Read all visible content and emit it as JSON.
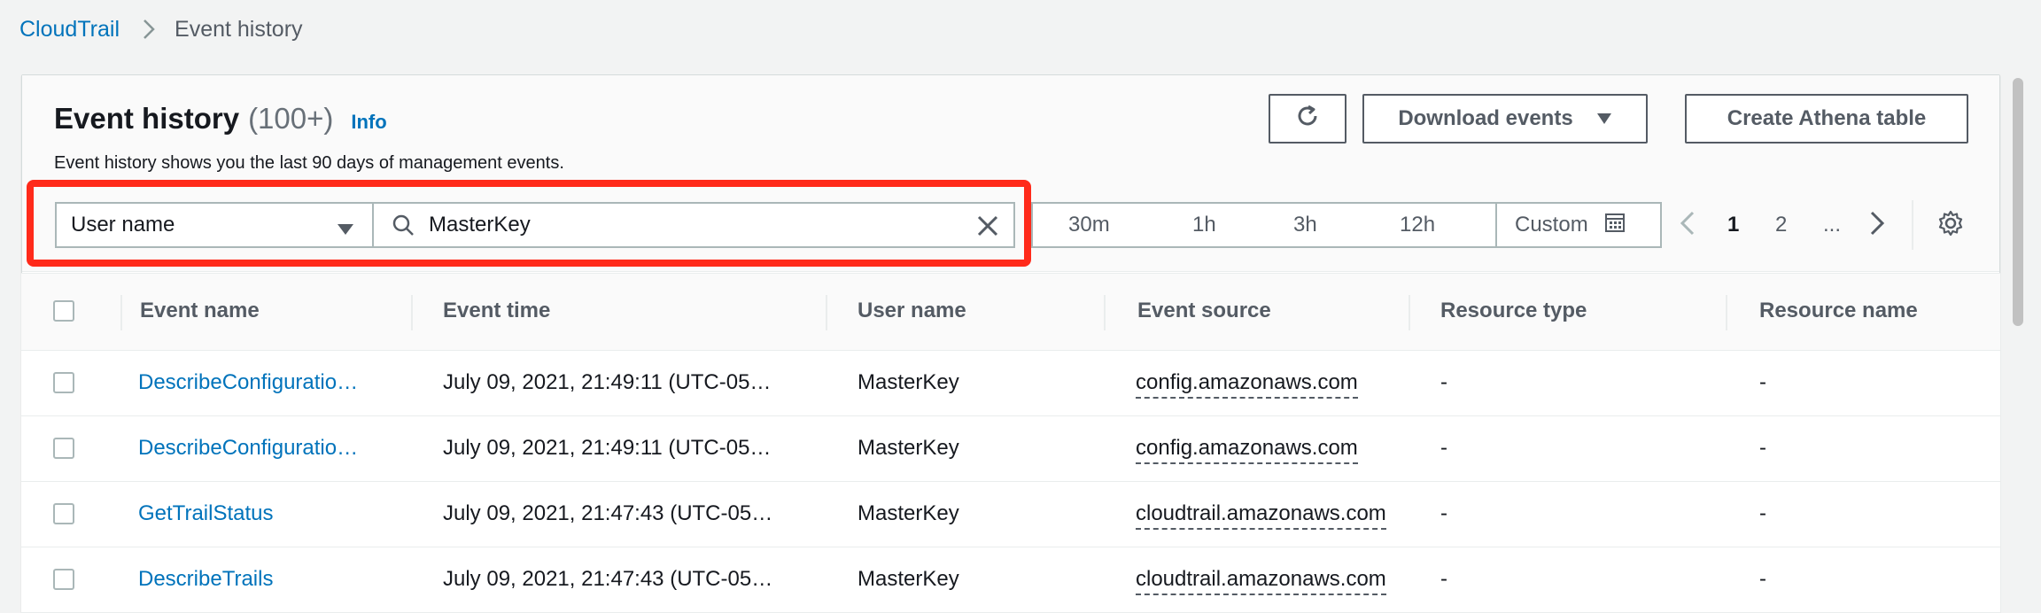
{
  "breadcrumb": {
    "parent": "CloudTrail",
    "current": "Event history"
  },
  "header": {
    "title": "Event history",
    "count": "(100+)",
    "info": "Info",
    "description": "Event history shows you the last 90 days of management events."
  },
  "actions": {
    "refresh_icon": "refresh-icon",
    "download_label": "Download events",
    "athena_label": "Create Athena table"
  },
  "filter": {
    "attribute": "User name",
    "value": "MasterKey",
    "highlight_color": "#ff2a1a"
  },
  "time_ranges": [
    "30m",
    "1h",
    "3h",
    "12h"
  ],
  "custom_range": "Custom",
  "pagination": {
    "pages": [
      "1",
      "2",
      "..."
    ],
    "current": "1"
  },
  "table": {
    "columns": [
      "Event name",
      "Event time",
      "User name",
      "Event source",
      "Resource type",
      "Resource name"
    ],
    "rows": [
      {
        "event_name": "DescribeConfiguratio…",
        "event_time": "July 09, 2021, 21:49:11 (UTC-05…",
        "user_name": "MasterKey",
        "event_source": "config.amazonaws.com",
        "resource_type": "-",
        "resource_name": "-"
      },
      {
        "event_name": "DescribeConfiguratio…",
        "event_time": "July 09, 2021, 21:49:11 (UTC-05…",
        "user_name": "MasterKey",
        "event_source": "config.amazonaws.com",
        "resource_type": "-",
        "resource_name": "-"
      },
      {
        "event_name": "GetTrailStatus",
        "event_time": "July 09, 2021, 21:47:43 (UTC-05…",
        "user_name": "MasterKey",
        "event_source": "cloudtrail.amazonaws.com",
        "resource_type": "-",
        "resource_name": "-"
      },
      {
        "event_name": "DescribeTrails",
        "event_time": "July 09, 2021, 21:47:43 (UTC-05…",
        "user_name": "MasterKey",
        "event_source": "cloudtrail.amazonaws.com",
        "resource_type": "-",
        "resource_name": "-"
      }
    ]
  },
  "colors": {
    "link": "#0073bb",
    "text": "#16191f",
    "muted": "#545b64",
    "border": "#aab7b8"
  }
}
